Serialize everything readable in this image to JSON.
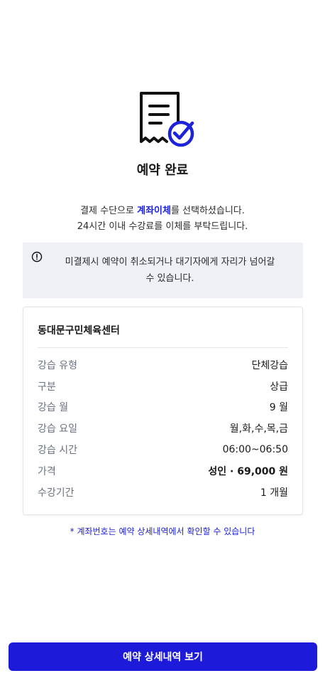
{
  "header": {
    "icon": "receipt-check-icon",
    "title": "예약 완료"
  },
  "payment_message": {
    "part1": "결제 수단으로 ",
    "highlight": "계좌이체",
    "part2": "를 선택하셨습니다.",
    "line2": "24시간 이내 수강료를 이체를 부탁드립니다."
  },
  "notice": {
    "icon": "alert-circle-icon",
    "text_line1": "미결제시 예약이 취소되거나 대기자에게 자리가 넘어갈",
    "text_line2": "수 있습니다."
  },
  "summary": {
    "facility": "동대문구민체육센터",
    "rows": [
      {
        "label": "강습 유형",
        "value": "단체강습"
      },
      {
        "label": "구분",
        "value": "상급"
      },
      {
        "label": "강습 월",
        "value": "9 월"
      },
      {
        "label": "강습 요일",
        "value": "월,화,수,목,금"
      },
      {
        "label": "강습 시간",
        "value": "06:00~06:50"
      },
      {
        "label": "가격",
        "value": "성인 · 69,000 원"
      },
      {
        "label": "수강기간",
        "value": "1 개월"
      }
    ]
  },
  "footnote": "* 계좌번호는 예약 상세내역에서 확인할 수 있습니다",
  "cta": {
    "label": "예약 상세내역 보기"
  },
  "colors": {
    "accent": "#1e1ad9",
    "notice_bg": "#eef0f5"
  }
}
